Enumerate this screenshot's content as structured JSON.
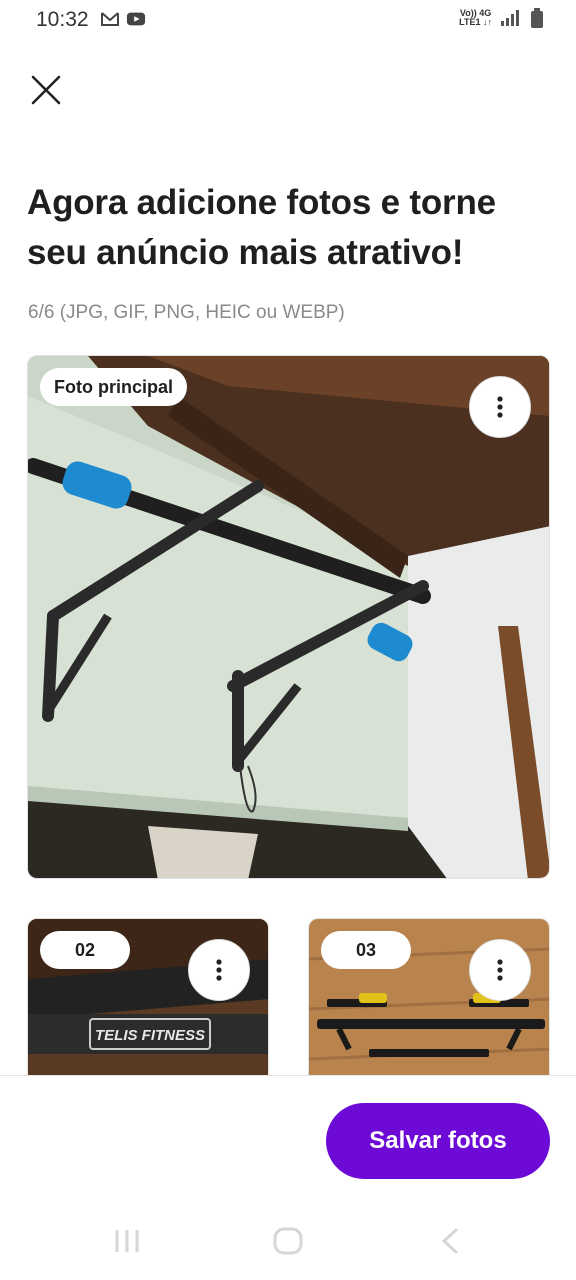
{
  "status_bar": {
    "time": "10:32",
    "left_icons": [
      "gmail-icon",
      "youtube-icon"
    ],
    "network_top": "Vo)) 4G",
    "network_bottom": "LTE1 ↓↑",
    "right_icons": [
      "signal-icon",
      "battery-icon"
    ]
  },
  "header": {
    "close_icon": "close-icon"
  },
  "title": "Agora adicione fotos e torne seu anúncio mais atrativo!",
  "subtitle": "6/6 (JPG, GIF, PNG, HEIC ou WEBP)",
  "photos": {
    "main_badge": "Foto principal",
    "thumbs": [
      {
        "badge": "02"
      },
      {
        "badge": "03"
      }
    ]
  },
  "footer": {
    "save_label": "Salvar fotos",
    "accent_color": "#6e0ad6"
  },
  "nav": {
    "icons": [
      "recent-apps-icon",
      "home-icon",
      "back-icon"
    ]
  }
}
